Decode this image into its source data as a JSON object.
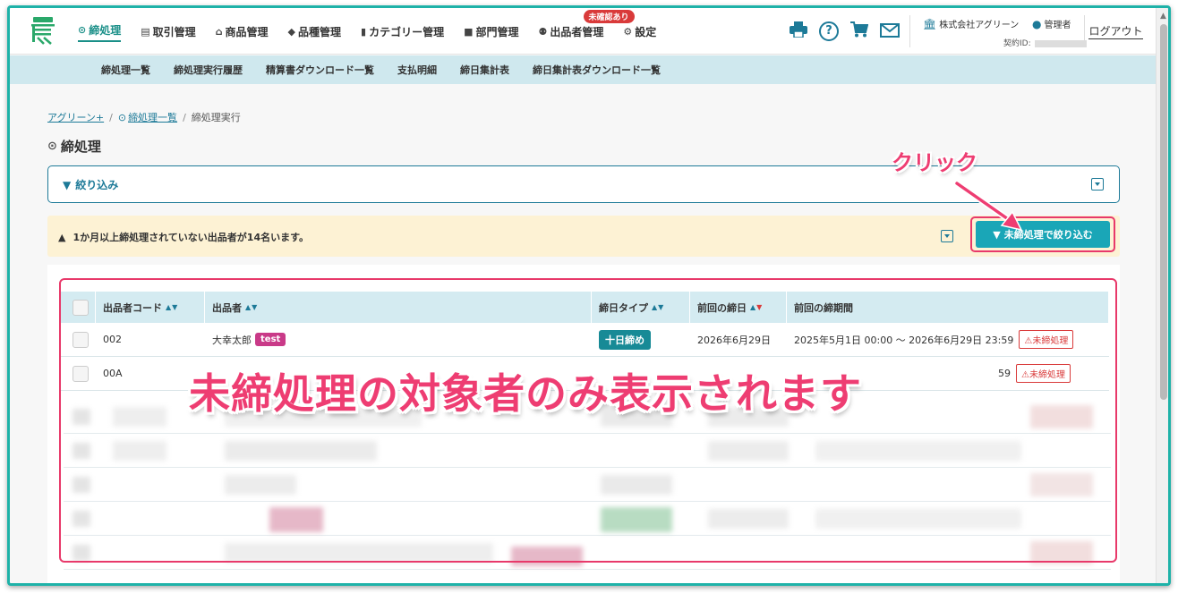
{
  "header": {
    "nav": [
      {
        "icon": "check-circle-icon",
        "glyph": "⊙",
        "label": "締処理",
        "active": true
      },
      {
        "icon": "ledger-icon",
        "glyph": "▤",
        "label": "取引管理"
      },
      {
        "icon": "basket-icon",
        "glyph": "⌂",
        "label": "商品管理"
      },
      {
        "icon": "tag-icon",
        "glyph": "◆",
        "label": "品種管理"
      },
      {
        "icon": "bookmark-icon",
        "glyph": "▮",
        "label": "カテゴリー管理"
      },
      {
        "icon": "folder-icon",
        "glyph": "■",
        "label": "部門管理"
      },
      {
        "icon": "users-icon",
        "glyph": "⚉",
        "label": "出品者管理",
        "badge": "未確認あり"
      },
      {
        "icon": "gear-icon",
        "glyph": "⚙",
        "label": "設定"
      }
    ],
    "company": "株式会社アグリーン",
    "user": "管理者",
    "contract_label": "契約ID:",
    "logout": "ログアウト"
  },
  "subnav": [
    "締処理一覧",
    "締処理実行履歴",
    "精算書ダウンロード一覧",
    "支払明細",
    "締日集計表",
    "締日集計表ダウンロード一覧"
  ],
  "breadcrumb": {
    "root": "アグリーン+",
    "list": "締処理一覧",
    "current": "締処理実行"
  },
  "page_title": "締処理",
  "filter": {
    "label": "絞り込み"
  },
  "alert": {
    "text": "1か月以上締処理されていない出品者が14名います。",
    "button": "未締処理で絞り込む"
  },
  "table": {
    "columns": [
      "出品者コード",
      "出品者",
      "締日タイプ",
      "前回の締日",
      "前回の締期間"
    ],
    "rows": [
      {
        "code": "002",
        "name": "大幸太郎",
        "tag": "test",
        "type": "十日締め",
        "last_close": "2026年6月29日",
        "period": "2025年5月1日 00:00 〜 2026年6月29日 23:59",
        "status": "未締処理"
      },
      {
        "code": "00A",
        "name": "",
        "tag": "",
        "type": "",
        "last_close": "",
        "period": "59",
        "status": "未締処理"
      }
    ]
  },
  "annotations": {
    "click": "クリック",
    "main": "未締処理の対象者のみ表示されます"
  },
  "colors": {
    "accent": "#1aa6b7",
    "brand": "#1d7a98",
    "annotation": "#ee3d72",
    "alert_bg": "#fdf2d4",
    "subnav_bg": "#cfe8ee"
  }
}
